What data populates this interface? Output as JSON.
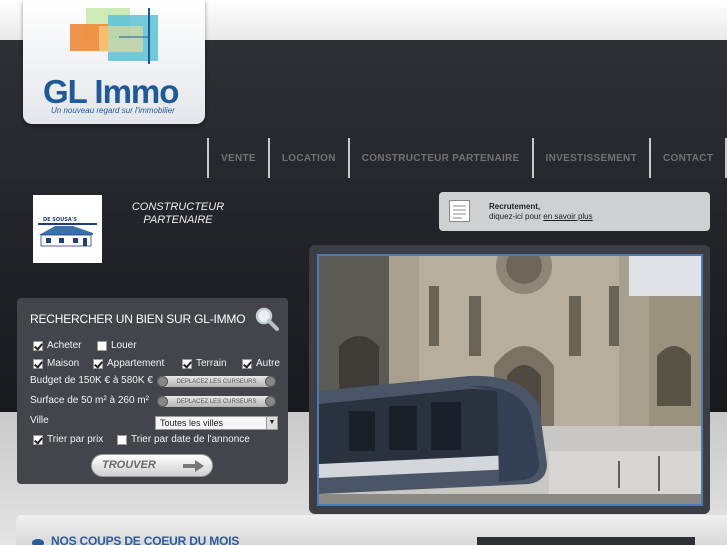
{
  "logo": {
    "name": "GL Immo",
    "tagline": "Un nouveau regard sur l'immobilier"
  },
  "nav": {
    "items": [
      "VENTE",
      "LOCATION",
      "CONSTRUCTEUR PARTENAIRE",
      "INVESTISSEMENT",
      "CONTACT"
    ]
  },
  "partner": {
    "title_line1": "CONSTRUCTEUR",
    "title_line2": "PARTENAIRE",
    "logo_text": "DE SOUSA'S"
  },
  "recruit": {
    "title": "Recrutement,",
    "text": "diquez-ici pour",
    "link": "en savoir plus"
  },
  "search": {
    "title": "RECHERCHER UN BIEN SUR GL-IMMO",
    "acheter": "Acheter",
    "louer": "Louer",
    "maison": "Maison",
    "appartement": "Appartement",
    "terrain": "Terrain",
    "autre": "Autre",
    "budget": "Budget de 150K € à 580K €",
    "surface": "Surface de 50 m² à 260 m²",
    "slider_hint": "DEPLACEZ LES CURSEURS",
    "ville_label": "Ville",
    "ville_value": "Toutes les villes",
    "sort_price": "Trier par prix",
    "sort_date": "Trier par date de l'annonce",
    "button": "TROUVER"
  },
  "checked": {
    "acheter": true,
    "louer": false,
    "maison": true,
    "appartement": true,
    "terrain": true,
    "autre": true,
    "sort_price": true,
    "sort_date": false
  },
  "coups": {
    "title": "NOS COUPS DE COEUR DU MOIS"
  },
  "colors": {
    "brand_blue": "#1e5a9a",
    "dark_bg": "#1d1f23",
    "panel": "#43454a"
  }
}
